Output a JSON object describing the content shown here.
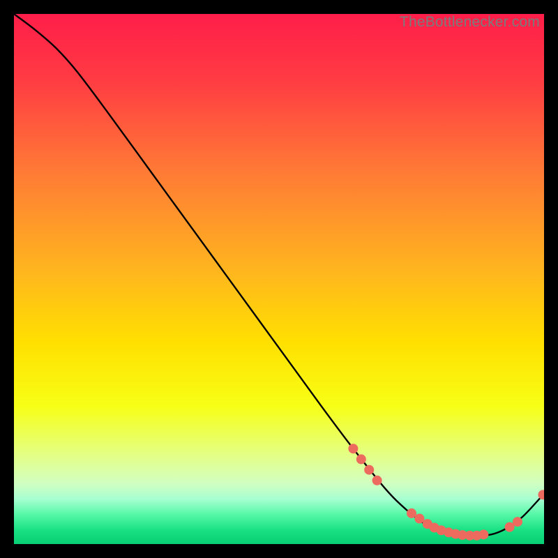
{
  "watermark": "TheBottlenecker.com",
  "chart_data": {
    "type": "line",
    "title": "",
    "xlabel": "",
    "ylabel": "",
    "xlim": [
      0,
      100
    ],
    "ylim": [
      0,
      100
    ],
    "background_gradient_stops": [
      {
        "pct": 0.0,
        "color": "#ff1e49"
      },
      {
        "pct": 0.12,
        "color": "#ff3a43"
      },
      {
        "pct": 0.3,
        "color": "#ff7b35"
      },
      {
        "pct": 0.48,
        "color": "#ffb41f"
      },
      {
        "pct": 0.62,
        "color": "#ffe000"
      },
      {
        "pct": 0.74,
        "color": "#f7ff16"
      },
      {
        "pct": 0.83,
        "color": "#e4ff83"
      },
      {
        "pct": 0.885,
        "color": "#d2ffc1"
      },
      {
        "pct": 0.915,
        "color": "#a7ffd1"
      },
      {
        "pct": 0.945,
        "color": "#54f7a6"
      },
      {
        "pct": 0.975,
        "color": "#17e082"
      },
      {
        "pct": 1.0,
        "color": "#07cf73"
      }
    ],
    "series": [
      {
        "name": "bottleneck-curve",
        "x": [
          0,
          4,
          8,
          12,
          18,
          26,
          34,
          42,
          50,
          58,
          64,
          70,
          74,
          78,
          82,
          86,
          90,
          93,
          96,
          100
        ],
        "y": [
          100,
          97,
          93.5,
          89,
          81,
          70,
          59,
          48,
          37,
          26,
          18,
          10.5,
          6.5,
          3.5,
          2.0,
          1.5,
          1.8,
          3.0,
          5.2,
          9.5
        ]
      }
    ],
    "markers": {
      "name": "highlighted-points",
      "color": "#ed6a5e",
      "radius": 7,
      "points": [
        {
          "x": 64.0,
          "y": 18.0
        },
        {
          "x": 65.5,
          "y": 16.0
        },
        {
          "x": 67.0,
          "y": 14.0
        },
        {
          "x": 68.5,
          "y": 12.0
        },
        {
          "x": 75.0,
          "y": 5.8
        },
        {
          "x": 76.5,
          "y": 4.8
        },
        {
          "x": 78.0,
          "y": 3.8
        },
        {
          "x": 79.3,
          "y": 3.1
        },
        {
          "x": 80.6,
          "y": 2.6
        },
        {
          "x": 82.0,
          "y": 2.2
        },
        {
          "x": 83.3,
          "y": 1.9
        },
        {
          "x": 84.6,
          "y": 1.7
        },
        {
          "x": 86.0,
          "y": 1.6
        },
        {
          "x": 87.3,
          "y": 1.6
        },
        {
          "x": 88.6,
          "y": 1.8
        },
        {
          "x": 93.5,
          "y": 3.2
        },
        {
          "x": 95.0,
          "y": 4.2
        },
        {
          "x": 99.8,
          "y": 9.3
        }
      ]
    }
  }
}
